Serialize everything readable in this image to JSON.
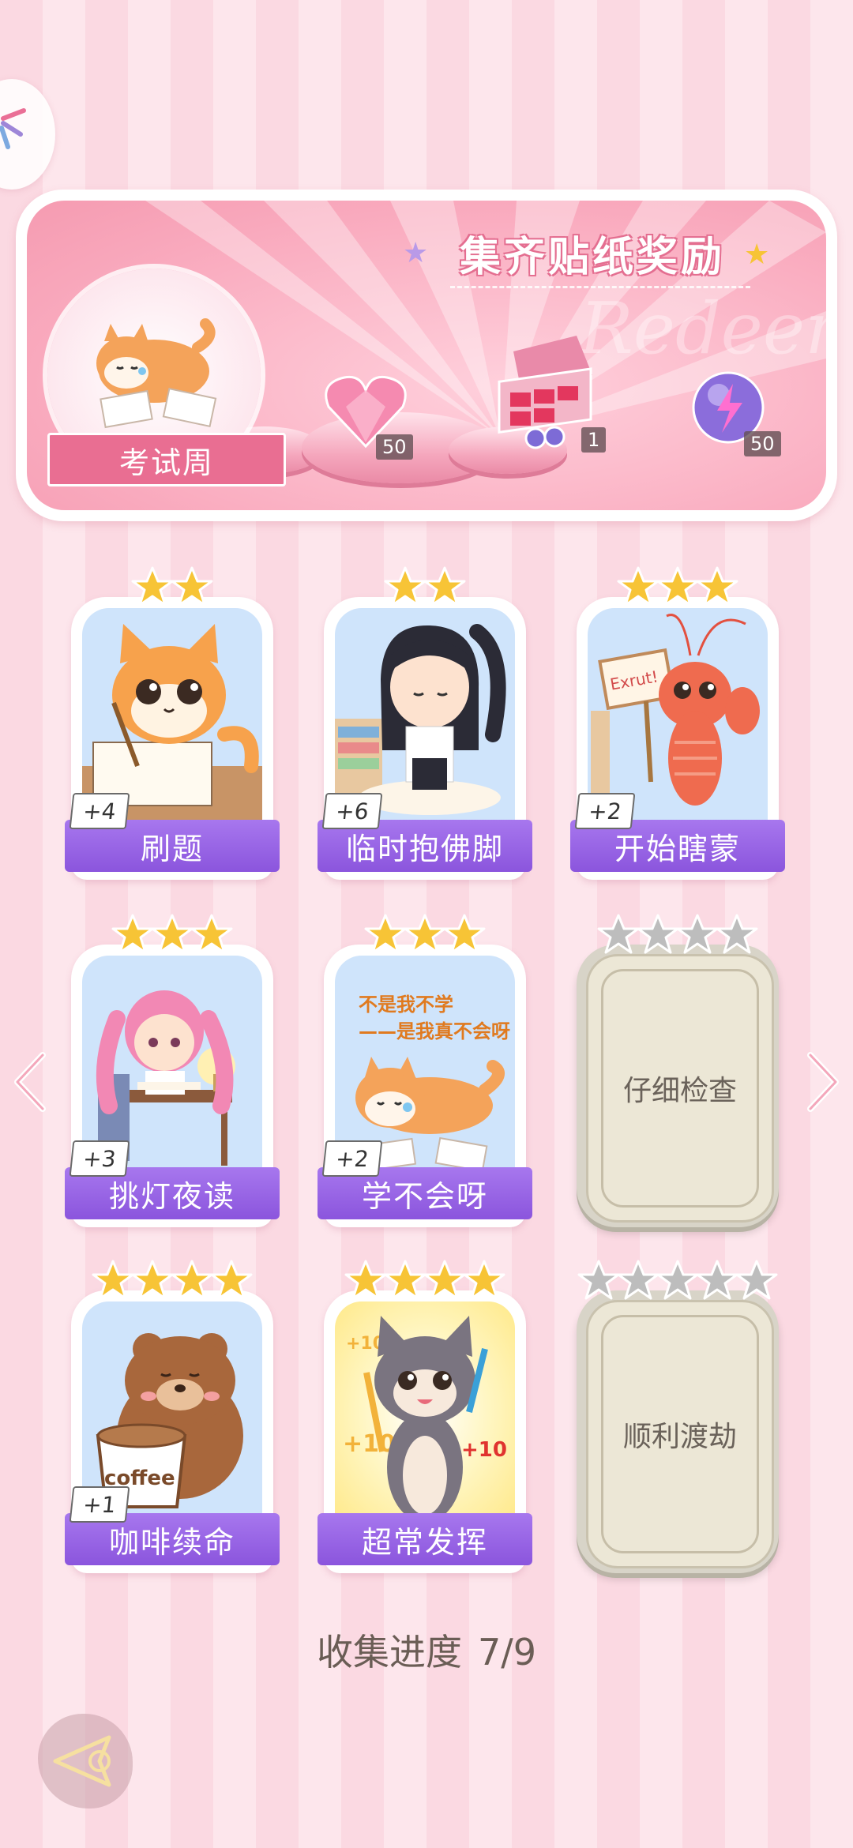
{
  "banner": {
    "title": "集齐贴纸奖励",
    "watermark": "Redeem",
    "theme_label": "考试周",
    "rewards": [
      {
        "icon": "pink-heart-gem-icon",
        "count": "50"
      },
      {
        "icon": "gift-box-icon",
        "count": "1"
      },
      {
        "icon": "purple-energy-orb-icon",
        "count": "50"
      }
    ]
  },
  "cards": [
    {
      "label": "刷题",
      "bonus": "+4",
      "stars": 2,
      "collected": true,
      "art": "orange-cat-studying"
    },
    {
      "label": "临时抱佛脚",
      "bonus": "+6",
      "stars": 2,
      "collected": true,
      "art": "girl-praying-books"
    },
    {
      "label": "开始瞎蒙",
      "bonus": "+2",
      "stars": 3,
      "collected": true,
      "art": "lobster-with-sign",
      "sign_text": "Exrut!"
    },
    {
      "label": "挑灯夜读",
      "bonus": "+3",
      "stars": 3,
      "collected": true,
      "art": "pink-girl-desk"
    },
    {
      "label": "学不会呀",
      "bonus": "+2",
      "stars": 3,
      "collected": true,
      "art": "shiba-lying",
      "caption": "不是我不学\n——是我真不会呀"
    },
    {
      "label": "仔细检查",
      "bonus": "",
      "stars": 4,
      "collected": false
    },
    {
      "label": "咖啡续命",
      "bonus": "+1",
      "stars": 4,
      "collected": true,
      "art": "bear-coffee",
      "cup_text": "coffee"
    },
    {
      "label": "超常发挥",
      "bonus": "",
      "stars": 4,
      "collected": true,
      "gold": true,
      "art": "cat-plus-ten",
      "floating_text": "+10"
    },
    {
      "label": "顺利渡劫",
      "bonus": "",
      "stars": 5,
      "collected": false
    }
  ],
  "progress": {
    "label": "收集进度",
    "value": "7/9"
  },
  "colors": {
    "accent_pink": "#e96e92",
    "label_purple": "#8b55dd",
    "star_gold": "#f7c436",
    "star_gray": "#bdbdbd"
  }
}
